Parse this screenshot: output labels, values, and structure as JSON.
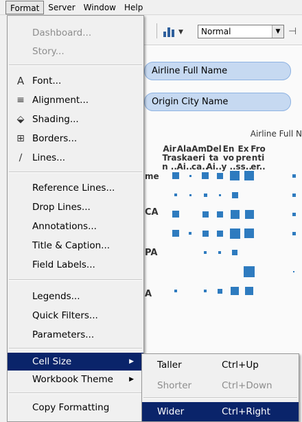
{
  "menubar": {
    "items": [
      {
        "label": "Format",
        "active": true
      },
      {
        "label": "Server"
      },
      {
        "label": "Window"
      },
      {
        "label": "Help"
      }
    ]
  },
  "toolbar": {
    "cell_size_value": "Normal"
  },
  "shelves": {
    "airline": "Airline Full Name",
    "origin": "Origin City Name"
  },
  "view": {
    "column_title": "Airline Full N",
    "name_header": "me",
    "columns": [
      {
        "label": "Air\nTra\nn .."
      },
      {
        "label": "Ala\nska\nAi.."
      },
      {
        "label": "Am\neri\nca.."
      },
      {
        "label": "Del\nta\nAi.."
      },
      {
        "label": "En\nvo\ny .."
      },
      {
        "label": "Ex\npre\nss.."
      },
      {
        "label": "Fro\nnti\ner.."
      }
    ],
    "row_labels": [
      "CA",
      "PA",
      "A"
    ]
  },
  "format_menu": {
    "items": [
      {
        "label": "Dashboard...",
        "disabled": true
      },
      {
        "label": "Story...",
        "disabled": true
      },
      {
        "label": "Font...",
        "icon": "font-icon"
      },
      {
        "label": "Alignment...",
        "icon": "alignment-icon"
      },
      {
        "label": "Shading...",
        "icon": "shading-icon"
      },
      {
        "label": "Borders...",
        "icon": "borders-icon"
      },
      {
        "label": "Lines...",
        "icon": "lines-icon"
      },
      {
        "label": "Reference Lines..."
      },
      {
        "label": "Drop Lines..."
      },
      {
        "label": "Annotations..."
      },
      {
        "label": "Title & Caption..."
      },
      {
        "label": "Field Labels..."
      },
      {
        "label": "Legends..."
      },
      {
        "label": "Quick Filters..."
      },
      {
        "label": "Parameters..."
      },
      {
        "label": "Cell Size",
        "submenu": true,
        "highlight": true
      },
      {
        "label": "Workbook Theme",
        "submenu": true
      },
      {
        "label": "Copy Formatting"
      }
    ]
  },
  "cell_size_submenu": {
    "items": [
      {
        "label": "Taller",
        "shortcut": "Ctrl+Up"
      },
      {
        "label": "Shorter",
        "shortcut": "Ctrl+Down",
        "disabled": true
      },
      {
        "label": "Wider",
        "shortcut": "Ctrl+Right",
        "highlight": true
      }
    ]
  },
  "colors": {
    "menu_highlight": "#0a246a",
    "mark_blue": "#2e7bbf",
    "pill_fill": "#c6d9f1"
  }
}
